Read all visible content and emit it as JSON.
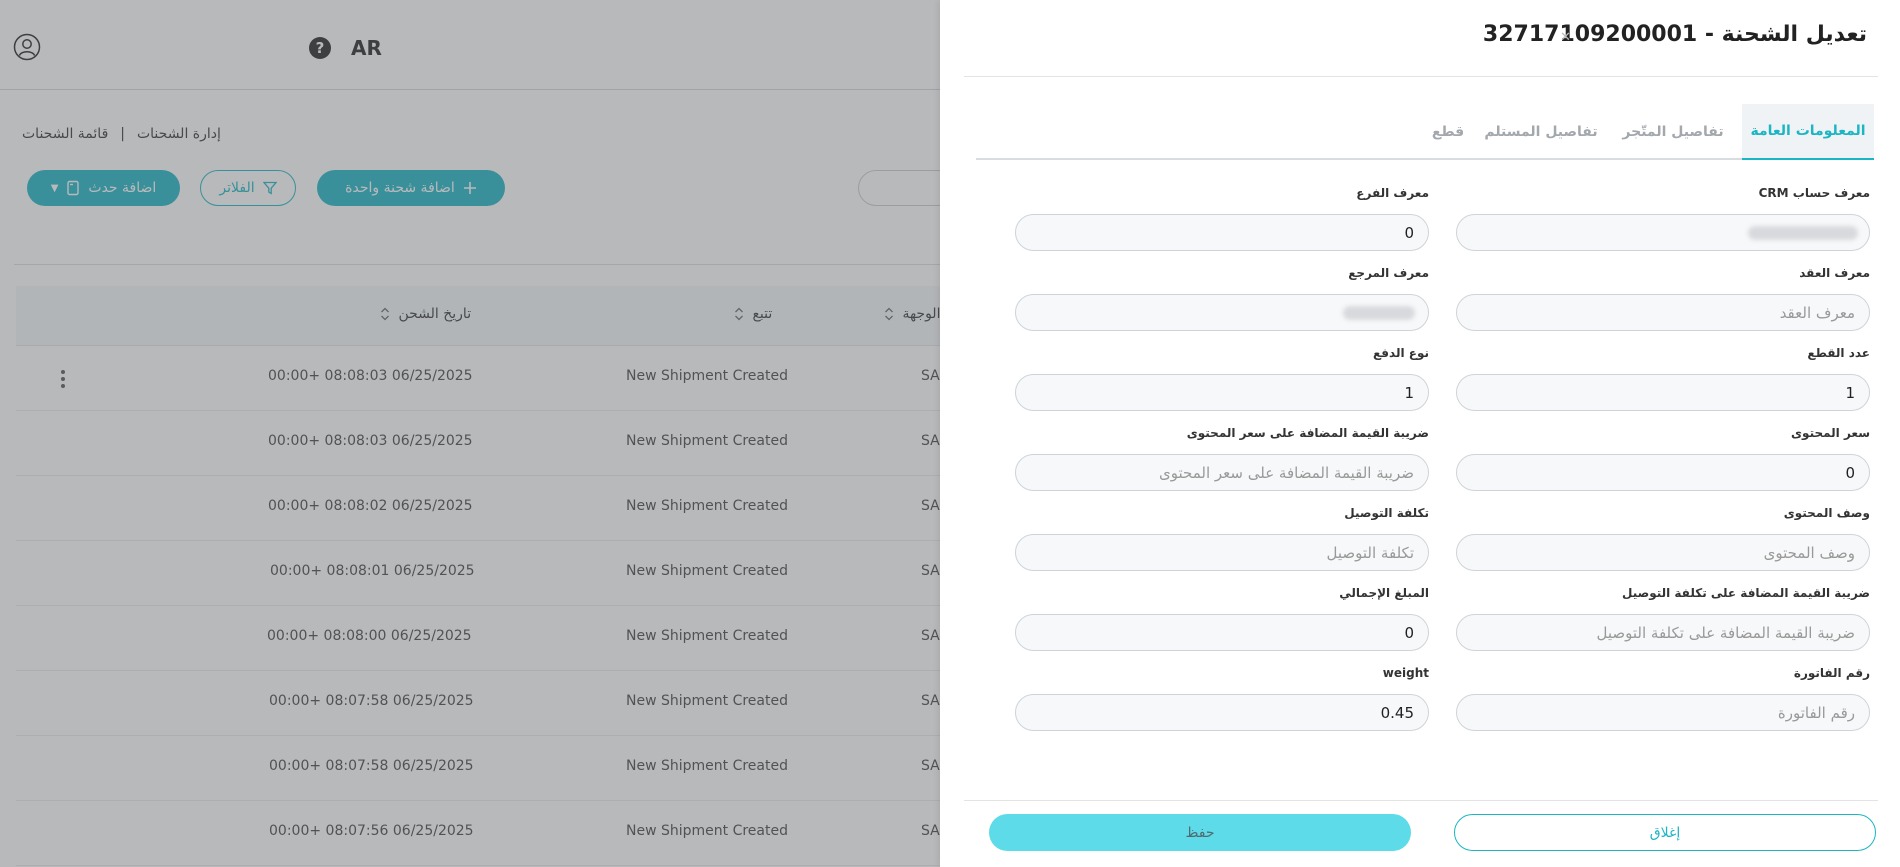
{
  "header": {
    "language": "AR"
  },
  "breadcrumb": {
    "parent": "إدارة الشحنات",
    "current": "قائمة الشحنات"
  },
  "toolbar": {
    "add_event_label": "اضافة حدث",
    "filter_label": "الفلاتر",
    "add_single_label": "اضافة شحنة واحدة"
  },
  "table": {
    "columns": {
      "ship_date": "تاريخ الشحن",
      "tracking": "تتبع",
      "destination": "الوجهة"
    },
    "rows": [
      {
        "date": "06/25/2025 08:08:03 +00:00",
        "status": "New Shipment Created",
        "dest": "SA"
      },
      {
        "date": "06/25/2025 08:08:03 +00:00",
        "status": "New Shipment Created",
        "dest": "SA"
      },
      {
        "date": "06/25/2025 08:08:02 +00:00",
        "status": "New Shipment Created",
        "dest": "SA"
      },
      {
        "date": "06/25/2025 08:08:01 +00:00",
        "status": "New Shipment Created",
        "dest": "SA"
      },
      {
        "date": "06/25/2025 08:08:00 +00:00",
        "status": "New Shipment Created",
        "dest": "SA"
      },
      {
        "date": "06/25/2025 08:07:58 +00:00",
        "status": "New Shipment Created",
        "dest": "SA"
      },
      {
        "date": "06/25/2025 08:07:58 +00:00",
        "status": "New Shipment Created",
        "dest": "SA"
      },
      {
        "date": "06/25/2025 08:07:56 +00:00",
        "status": "New Shipment Created",
        "dest": "SA"
      }
    ]
  },
  "drawer": {
    "title": "تعديل الشحنة - 32717109200001",
    "tabs": [
      "المعلومات العامة",
      "تفاصيل المتّجر",
      "تفاصيل المستلم",
      "قطع"
    ],
    "fields": {
      "crm_account_id": {
        "label": "معرف حساب CRM",
        "value": ""
      },
      "branch_id": {
        "label": "معرف الفرع",
        "value": "0"
      },
      "contract_id": {
        "label": "معرف العقد",
        "placeholder": "معرف العقد"
      },
      "reference_id": {
        "label": "معرف المرجع",
        "value": ""
      },
      "pieces_count": {
        "label": "عدد القطع",
        "value": "1"
      },
      "payment_type": {
        "label": "نوع الدفع",
        "value": "1"
      },
      "content_price": {
        "label": "سعر المحتوى",
        "value": "0"
      },
      "content_price_vat": {
        "label": "ضريبة القيمة المضافة على سعر المحتوى",
        "placeholder": "ضريبة القيمة المضافة على سعر المحتوى"
      },
      "content_description": {
        "label": "وصف المحتوى",
        "placeholder": "وصف المحتوى"
      },
      "delivery_cost": {
        "label": "تكلفة التوصيل",
        "placeholder": "تكلفة التوصيل"
      },
      "delivery_cost_vat": {
        "label": "ضريبة القيمة المضافة على تكلفة التوصيل",
        "placeholder": "ضريبة القيمة المضافة على تكلفة التوصيل"
      },
      "total_amount": {
        "label": "المبلغ الإجمالي",
        "value": "0"
      },
      "invoice_number": {
        "label": "رقم الفاتورة",
        "placeholder": "رقم الفاتورة"
      },
      "weight": {
        "label": "weight",
        "value": "0.45"
      }
    },
    "buttons": {
      "close_label": "إغلاق",
      "save_label": "حفظ"
    }
  },
  "colors": {
    "accent": "#1cb5c4",
    "save_button": "#5ddbe8",
    "overlay": "#5f6469"
  }
}
